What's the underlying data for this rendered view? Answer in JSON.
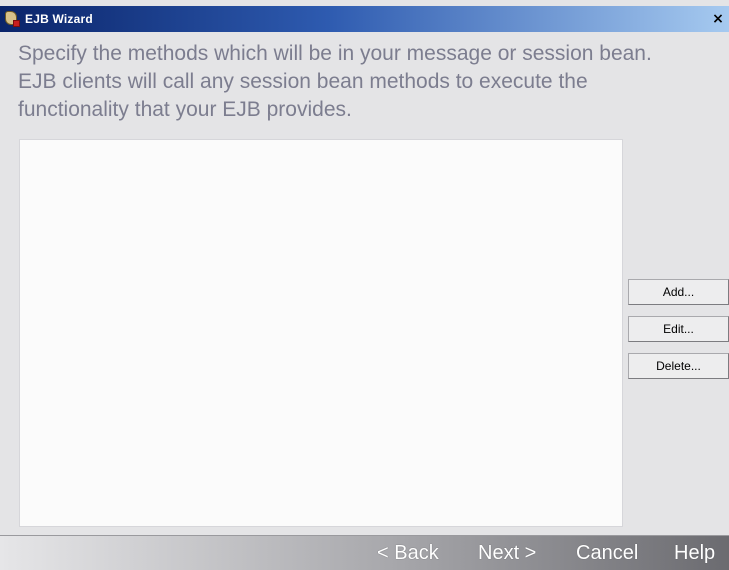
{
  "window": {
    "title": "EJB Wizard",
    "close_label": "×"
  },
  "description": {
    "lines": [
      "Specify the methods which will be in your message or session bean.",
      "EJB clients will call any session bean methods to execute the",
      "functionality that your EJB provides."
    ]
  },
  "methods_list": {
    "items": []
  },
  "actions": {
    "add_label": "Add...",
    "edit_label": "Edit...",
    "delete_label": "Delete..."
  },
  "navigation": {
    "back_label": "< Back",
    "next_label": "Next >",
    "cancel_label": "Cancel",
    "help_label": "Help"
  },
  "colors": {
    "titlebar_start": "#0a246a",
    "titlebar_end": "#a6caf0",
    "description_text": "#7c7d8f",
    "window_background": "#e4e4e6"
  }
}
